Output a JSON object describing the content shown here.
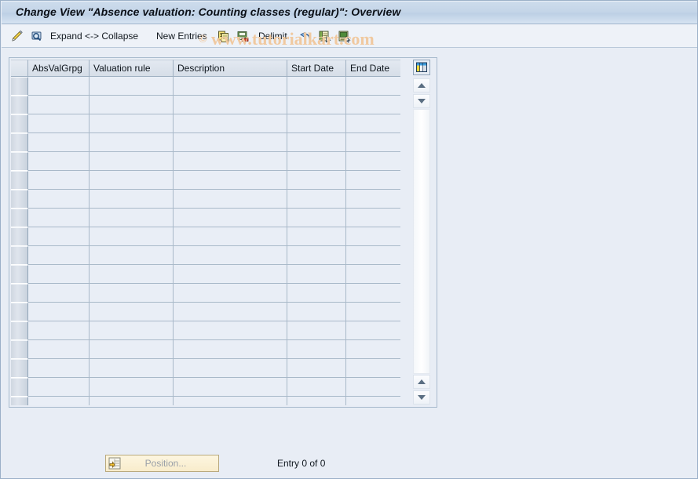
{
  "window": {
    "title": "Change View \"Absence valuation: Counting classes (regular)\": Overview"
  },
  "watermark": {
    "symbol": "©",
    "text": " www.tutorialkart.com",
    "color": "#f0c9a0"
  },
  "toolbar": {
    "items": [
      {
        "name": "display-change-icon",
        "label": "",
        "icon": "pencil-magnifier-icon"
      },
      {
        "name": "check-entries-icon",
        "label": "",
        "icon": "magnifier-screen-icon"
      },
      {
        "name": "expand-collapse-button",
        "label": "Expand <-> Collapse",
        "icon": ""
      },
      {
        "name": "new-entries-button",
        "label": "New Entries",
        "icon": ""
      },
      {
        "name": "copy-as-button",
        "label": "",
        "icon": "copy-icon"
      },
      {
        "name": "save-button",
        "label": "",
        "icon": "save-floppy-icon"
      },
      {
        "name": "delimit-button",
        "label": "Delimit",
        "icon": ""
      },
      {
        "name": "undo-button",
        "label": "",
        "icon": "undo-arrow-icon"
      },
      {
        "name": "select-all-button",
        "label": "",
        "icon": "table-select-icon"
      },
      {
        "name": "select-block-button",
        "label": "",
        "icon": "table-block-icon"
      }
    ]
  },
  "table": {
    "columns": [
      {
        "key": "select",
        "label": ""
      },
      {
        "key": "absvalgrpg",
        "label": "AbsValGrpg"
      },
      {
        "key": "valuation_rule",
        "label": "Valuation rule"
      },
      {
        "key": "description",
        "label": "Description"
      },
      {
        "key": "start_date",
        "label": "Start Date"
      },
      {
        "key": "end_date",
        "label": "End Date"
      }
    ],
    "rows": [],
    "empty_row_count": 18,
    "column_config_icon": "table-columns-icon"
  },
  "scrollbar": {
    "up_icon": "arrow-up-icon",
    "down_icon": "arrow-down-icon"
  },
  "footer": {
    "position_button_label": "Position...",
    "position_button_icon": "position-jump-icon",
    "entry_count_label": "Entry 0 of 0"
  }
}
